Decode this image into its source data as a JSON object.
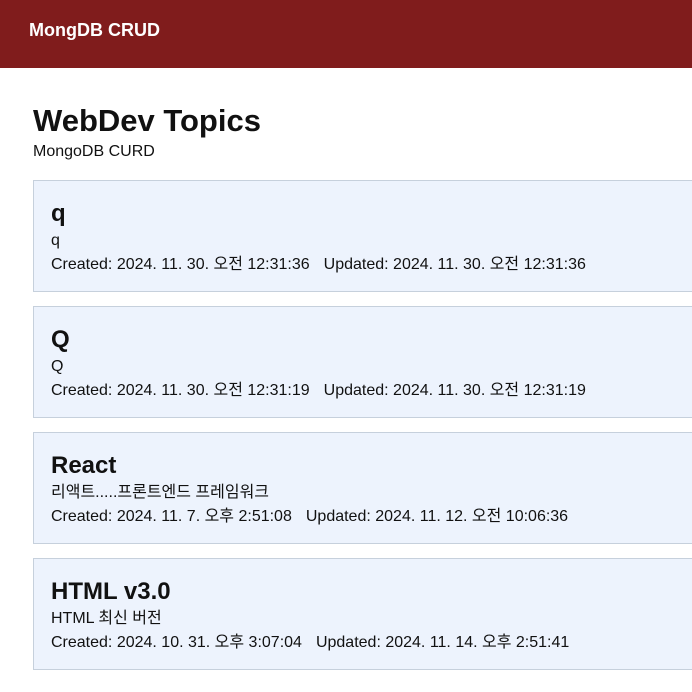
{
  "navbar": {
    "brand": "MongDB CRUD"
  },
  "page": {
    "title": "WebDev Topics",
    "subtitle": "MongoDB CURD"
  },
  "topics": [
    {
      "title": "q",
      "description": "q",
      "created": "Created: 2024. 11. 30. 오전 12:31:36",
      "updated": "Updated: 2024. 11. 30. 오전 12:31:36"
    },
    {
      "title": "Q",
      "description": "Q",
      "created": "Created: 2024. 11. 30. 오전 12:31:19",
      "updated": "Updated: 2024. 11. 30. 오전 12:31:19"
    },
    {
      "title": "React",
      "description": "리액트.....프론트엔드 프레임워크",
      "created": "Created: 2024. 11. 7. 오후 2:51:08",
      "updated": "Updated: 2024. 11. 12. 오전 10:06:36"
    },
    {
      "title": "HTML v3.0",
      "description": "HTML 최신 버전",
      "created": "Created: 2024. 10. 31. 오후 3:07:04",
      "updated": "Updated: 2024. 11. 14. 오후 2:51:41"
    }
  ],
  "colors": {
    "navbar_bg": "#801c1c",
    "card_bg": "#edf3fd",
    "card_border": "#c6d0dc"
  }
}
